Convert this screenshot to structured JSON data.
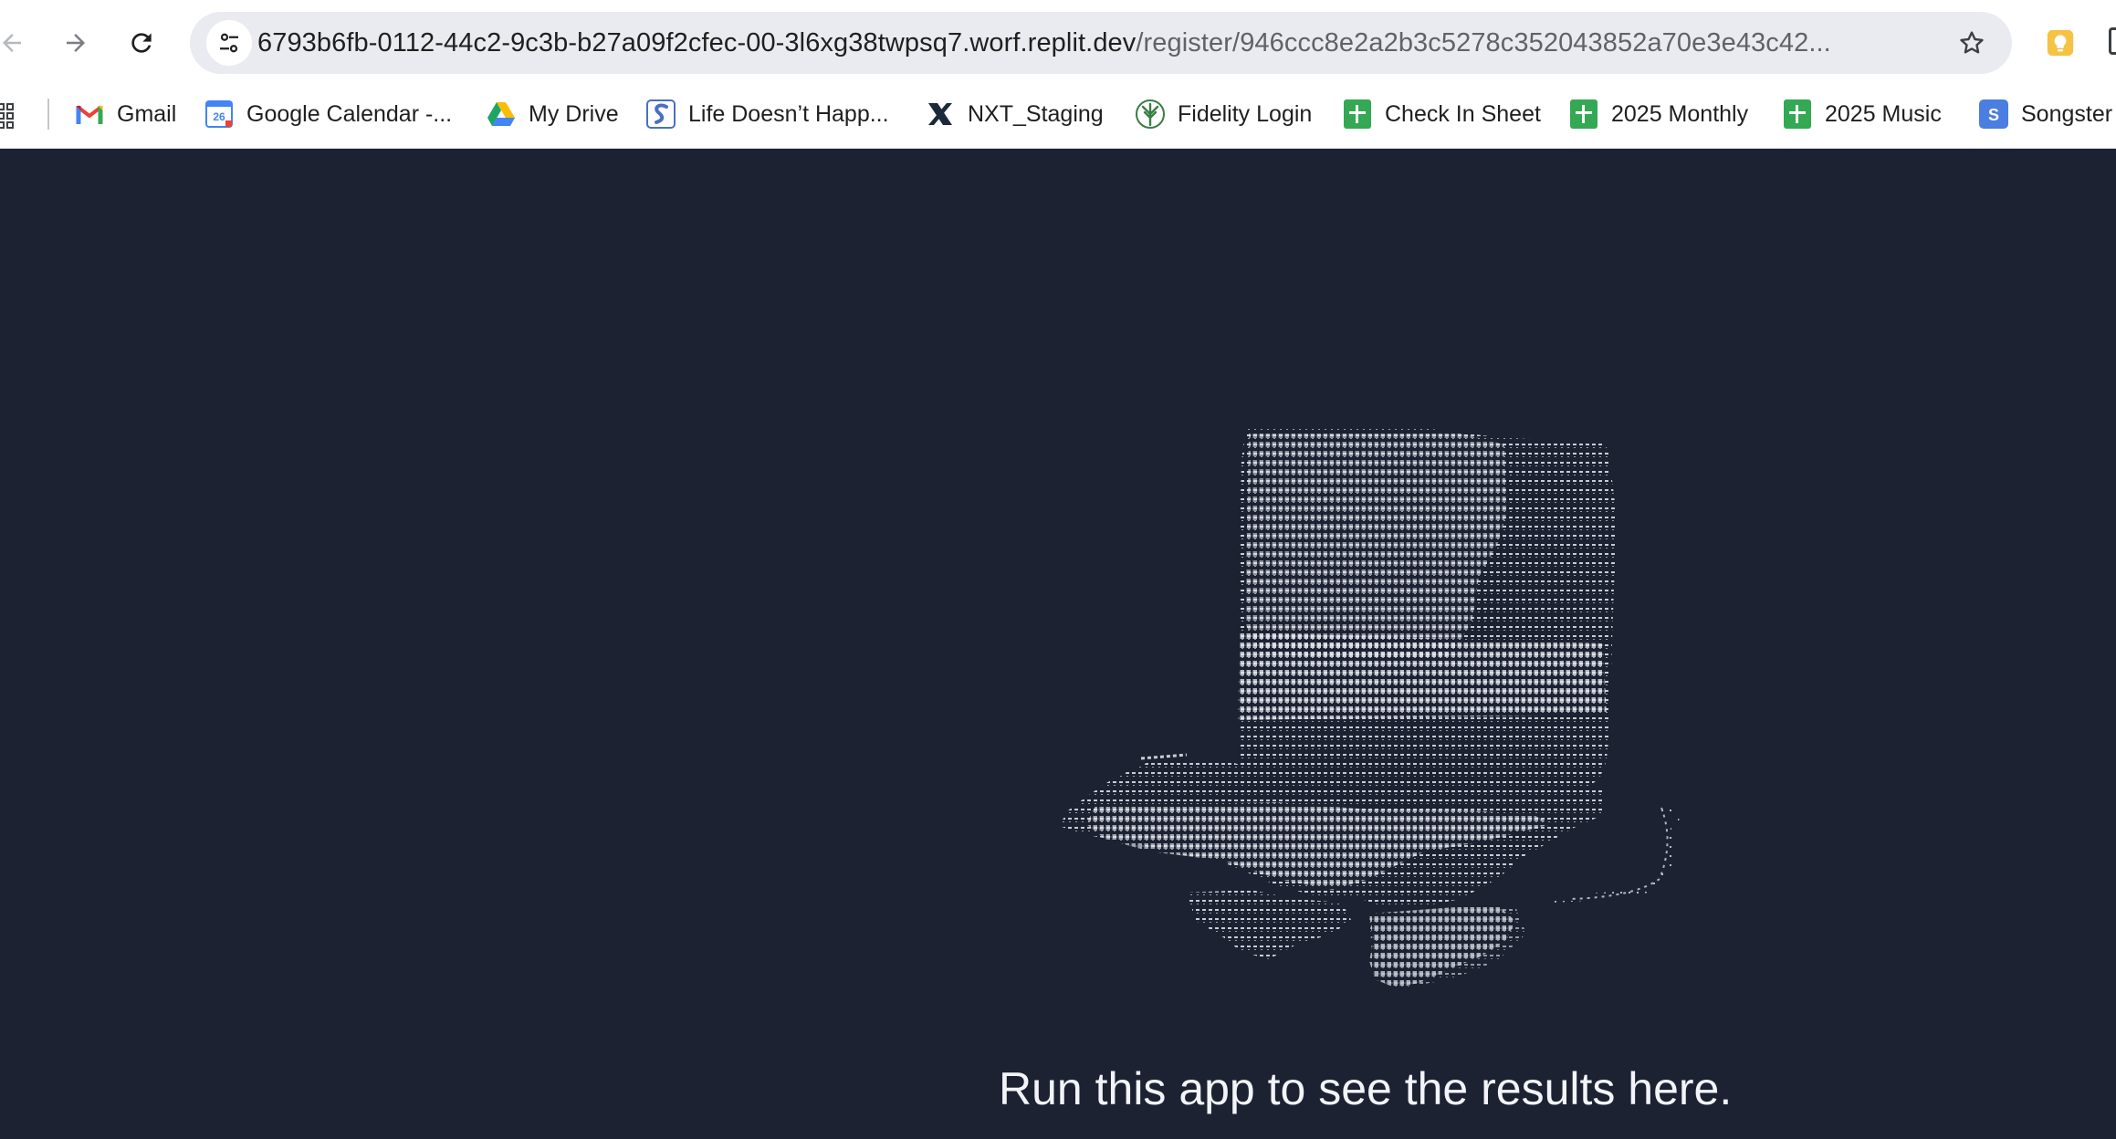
{
  "browser": {
    "url_host": "6793b6fb-0112-44c2-9c3b-b27a09f2cfec-00-3l6xg38twpsq7.worf.replit.dev",
    "url_path": "/register/946ccc8e2a2b3c5278c352043852a70e3e43c42...",
    "back_icon": "arrow-left",
    "forward_icon": "arrow-right",
    "reload_icon": "reload",
    "site_info_icon": "tune",
    "bookmark_star_icon": "star-outline",
    "extension_icon": "lightbulb"
  },
  "bookmarks": [
    {
      "label": "Gmail",
      "icon": "gmail"
    },
    {
      "label": "Google Calendar -...",
      "icon": "calendar-26"
    },
    {
      "label": "My Drive",
      "icon": "google-drive"
    },
    {
      "label": "Life Doesn’t Happ...",
      "icon": "s-logo"
    },
    {
      "label": "NXT_Staging",
      "icon": "x-logo"
    },
    {
      "label": "Fidelity Login",
      "icon": "fidelity-tree"
    },
    {
      "label": "Check In Sheet",
      "icon": "sheets"
    },
    {
      "label": "2025 Monthly",
      "icon": "sheets"
    },
    {
      "label": "2025 Music",
      "icon": "sheets"
    },
    {
      "label": "Songster",
      "icon": "songster"
    }
  ],
  "page": {
    "illustration": "ascii-art-top-hat",
    "message": "Run this app to see the results here."
  },
  "colors": {
    "page_background": "#1c2232",
    "ascii_art": "#e6e8ee",
    "omnibox": "#e9ebf0"
  }
}
